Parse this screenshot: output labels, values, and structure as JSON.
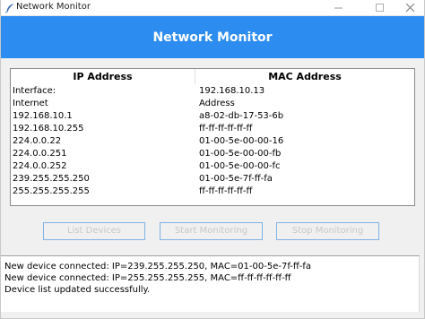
{
  "window": {
    "title": "Network Monitor",
    "app_icon": "feather-icon"
  },
  "header": {
    "title": "Network Monitor",
    "color": "#2d8cf0"
  },
  "table": {
    "columns": [
      "IP Address",
      "MAC Address"
    ],
    "rows": [
      {
        "ip": "Interface:",
        "mac": "192.168.10.13"
      },
      {
        "ip": "Internet",
        "mac": "Address"
      },
      {
        "ip": "192.168.10.1",
        "mac": "a8-02-db-17-53-6b"
      },
      {
        "ip": "192.168.10.255",
        "mac": "ff-ff-ff-ff-ff-ff"
      },
      {
        "ip": "224.0.0.22",
        "mac": "01-00-5e-00-00-16"
      },
      {
        "ip": "224.0.0.251",
        "mac": "01-00-5e-00-00-fb"
      },
      {
        "ip": "224.0.0.252",
        "mac": "01-00-5e-00-00-fc"
      },
      {
        "ip": "239.255.255.250",
        "mac": "01-00-5e-7f-ff-fa"
      },
      {
        "ip": "255.255.255.255",
        "mac": "ff-ff-ff-ff-ff-ff"
      }
    ]
  },
  "buttons": {
    "list_devices": "List Devices",
    "start_monitoring": "Start Monitoring",
    "stop_monitoring": "Stop Monitoring"
  },
  "log": {
    "lines": [
      "New device connected: IP=239.255.255.250, MAC=01-00-5e-7f-ff-fa",
      "New device connected: IP=255.255.255.255, MAC=ff-ff-ff-ff-ff-ff",
      "Device list updated successfully."
    ]
  }
}
